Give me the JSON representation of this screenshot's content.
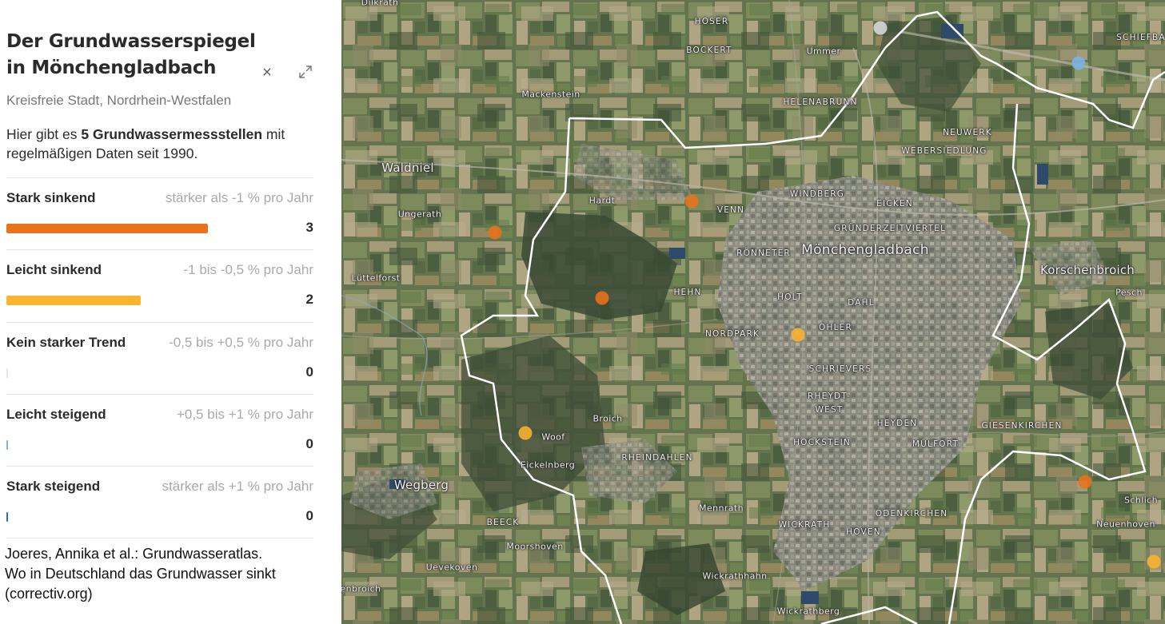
{
  "panel": {
    "title": "Der Grundwasserspiegel in Mönchengladbach",
    "close_symbol": "×",
    "close_icon": "close-icon",
    "expand_icon": "expand-icon",
    "region": "Kreisfreie Stadt, Nordrhein-Westfalen",
    "summary": {
      "prefix": "Hier gibt es ",
      "highlight": "5 Grundwassermessstellen",
      "suffix": " mit regelmäßigen Daten seit 1990."
    },
    "max_count": 5,
    "trends": [
      {
        "label": "Stark sinkend",
        "range": "stärker als -1 % pro Jahr",
        "count": 3,
        "color": "#e8731a"
      },
      {
        "label": "Leicht sinkend",
        "range": "-1 bis -0,5 % pro Jahr",
        "count": 2,
        "color": "#fbb430"
      },
      {
        "label": "Kein starker Trend",
        "range": "-0,5 bis +0,5 % pro Jahr",
        "count": 0,
        "color": "#e6e6e6"
      },
      {
        "label": "Leicht steigend",
        "range": "+0,5 bis +1 % pro Jahr",
        "count": 0,
        "color": "#7ab3e6"
      },
      {
        "label": "Stark steigend",
        "range": "stärker als +1 % pro Jahr",
        "count": 0,
        "color": "#2a6cbf"
      }
    ],
    "source_lines": [
      "Joeres, Annika et al.: Grundwasseratlas.",
      "Wo in Deutschland das Grundwasser sinkt",
      "(correctiv.org)"
    ]
  },
  "map": {
    "labels": [
      {
        "text": "Dilkrath",
        "kind": "place"
      },
      {
        "text": "HOSER",
        "kind": "district"
      },
      {
        "text": "BOCKERT",
        "kind": "district"
      },
      {
        "text": "Ummer",
        "kind": "place"
      },
      {
        "text": "SCHIEFBA",
        "kind": "district"
      },
      {
        "text": "Mackenstein",
        "kind": "place"
      },
      {
        "text": "HELENABRUNN",
        "kind": "district"
      },
      {
        "text": "NEUWERK",
        "kind": "district"
      },
      {
        "text": "WEBERSIEDLUNG",
        "kind": "district"
      },
      {
        "text": "Waldniel",
        "kind": "town"
      },
      {
        "text": "Hardt",
        "kind": "place"
      },
      {
        "text": "WINDBERG",
        "kind": "district"
      },
      {
        "text": "EICKEN",
        "kind": "district"
      },
      {
        "text": "Ungerath",
        "kind": "place"
      },
      {
        "text": "VENN",
        "kind": "district"
      },
      {
        "text": "GRÜNDERZEITVIERTEL",
        "kind": "district"
      },
      {
        "text": "RÖNNETER",
        "kind": "district"
      },
      {
        "text": "Mönchengladbach",
        "kind": "city"
      },
      {
        "text": "Korschenbroich",
        "kind": "town"
      },
      {
        "text": "Lüttelforst",
        "kind": "place"
      },
      {
        "text": "HEHN",
        "kind": "district"
      },
      {
        "text": "Pesch",
        "kind": "place"
      },
      {
        "text": "HOLT",
        "kind": "district"
      },
      {
        "text": "DAHL",
        "kind": "district"
      },
      {
        "text": "NORDPARK",
        "kind": "district"
      },
      {
        "text": "OHLER",
        "kind": "district"
      },
      {
        "text": "SCHRIEVERS",
        "kind": "district"
      },
      {
        "text": "RHEYDT-",
        "kind": "district"
      },
      {
        "text": "WEST",
        "kind": "district"
      },
      {
        "text": "Broich",
        "kind": "place"
      },
      {
        "text": "HEYDEN",
        "kind": "district"
      },
      {
        "text": "GIESENKIRCHEN",
        "kind": "district"
      },
      {
        "text": "Woof",
        "kind": "place"
      },
      {
        "text": "HOCKSTEIN",
        "kind": "district"
      },
      {
        "text": "MÜLFORT",
        "kind": "district"
      },
      {
        "text": "RHEINDAHLEN",
        "kind": "district"
      },
      {
        "text": "Eickelnberg",
        "kind": "place"
      },
      {
        "text": "Wegberg",
        "kind": "town"
      },
      {
        "text": "Schlich",
        "kind": "place"
      },
      {
        "text": "Mennrath",
        "kind": "place"
      },
      {
        "text": "ODENKIRCHEN",
        "kind": "district"
      },
      {
        "text": "BEECK",
        "kind": "district"
      },
      {
        "text": "Neuenhoven",
        "kind": "place"
      },
      {
        "text": "WICKRATH",
        "kind": "district"
      },
      {
        "text": "HOVEN",
        "kind": "district"
      },
      {
        "text": "Moorshoven",
        "kind": "place"
      },
      {
        "text": "Uevekoven",
        "kind": "place"
      },
      {
        "text": "Wickrathhahn",
        "kind": "place"
      },
      {
        "text": "enbroich",
        "kind": "place"
      },
      {
        "text": "Wickrathberg",
        "kind": "place"
      }
    ],
    "stations": [
      {
        "trend": "Stark sinkend",
        "color": "#e8731a"
      },
      {
        "trend": "Stark sinkend",
        "color": "#e8731a"
      },
      {
        "trend": "Stark sinkend",
        "color": "#e8731a"
      },
      {
        "trend": "Stark sinkend",
        "color": "#e8731a"
      },
      {
        "trend": "Leicht sinkend",
        "color": "#fbb430"
      },
      {
        "trend": "Leicht sinkend",
        "color": "#fbb430"
      },
      {
        "trend": "Leicht sinkend",
        "color": "#fbb430"
      },
      {
        "trend": "Keine Daten",
        "color": "#d9d9d9"
      },
      {
        "trend": "Leicht steigend",
        "color": "#7ab3e6"
      }
    ]
  }
}
